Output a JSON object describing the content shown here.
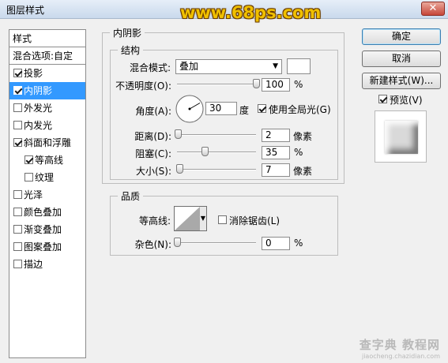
{
  "window": {
    "title": "图层样式",
    "watermark": "www.68ps.com",
    "close_glyph": "✕"
  },
  "left_panel": {
    "header": "样式",
    "blend_options": "混合选项:自定",
    "items": [
      {
        "label": "投影",
        "checked": true
      },
      {
        "label": "内阴影",
        "checked": true,
        "selected": true
      },
      {
        "label": "外发光",
        "checked": false
      },
      {
        "label": "内发光",
        "checked": false
      },
      {
        "label": "斜面和浮雕",
        "checked": true
      },
      {
        "label": "等高线",
        "checked": true,
        "sub": true
      },
      {
        "label": "纹理",
        "checked": false,
        "sub": true
      },
      {
        "label": "光泽",
        "checked": false
      },
      {
        "label": "颜色叠加",
        "checked": false
      },
      {
        "label": "渐变叠加",
        "checked": false
      },
      {
        "label": "图案叠加",
        "checked": false
      },
      {
        "label": "描边",
        "checked": false
      }
    ]
  },
  "section_title": "内阴影",
  "structure": {
    "title": "结构",
    "blend_mode_label": "混合模式:",
    "blend_mode_value": "叠加",
    "blend_color": "#ffffff",
    "opacity_label": "不透明度(O):",
    "opacity_value": "100",
    "opacity_unit": "%",
    "angle_label": "角度(A):",
    "angle_value": "30",
    "angle_unit": "度",
    "use_global_light_label": "使用全局光(G)",
    "use_global_light": true,
    "distance_label": "距离(D):",
    "distance_value": "2",
    "distance_unit": "像素",
    "choke_label": "阻塞(C):",
    "choke_value": "35",
    "choke_unit": "%",
    "size_label": "大小(S):",
    "size_value": "7",
    "size_unit": "像素"
  },
  "quality": {
    "title": "品质",
    "contour_label": "等高线:",
    "anti_alias_label": "消除锯齿(L)",
    "anti_alias": false,
    "noise_label": "杂色(N):",
    "noise_value": "0",
    "noise_unit": "%"
  },
  "buttons": {
    "ok": "确定",
    "cancel": "取消",
    "new_style": "新建样式(W)...",
    "preview_label": "预览(V)",
    "preview_checked": true
  },
  "footer_watermark": {
    "line1": "查字典 教程网",
    "line2": "jiaocheng.chazidian.com"
  }
}
